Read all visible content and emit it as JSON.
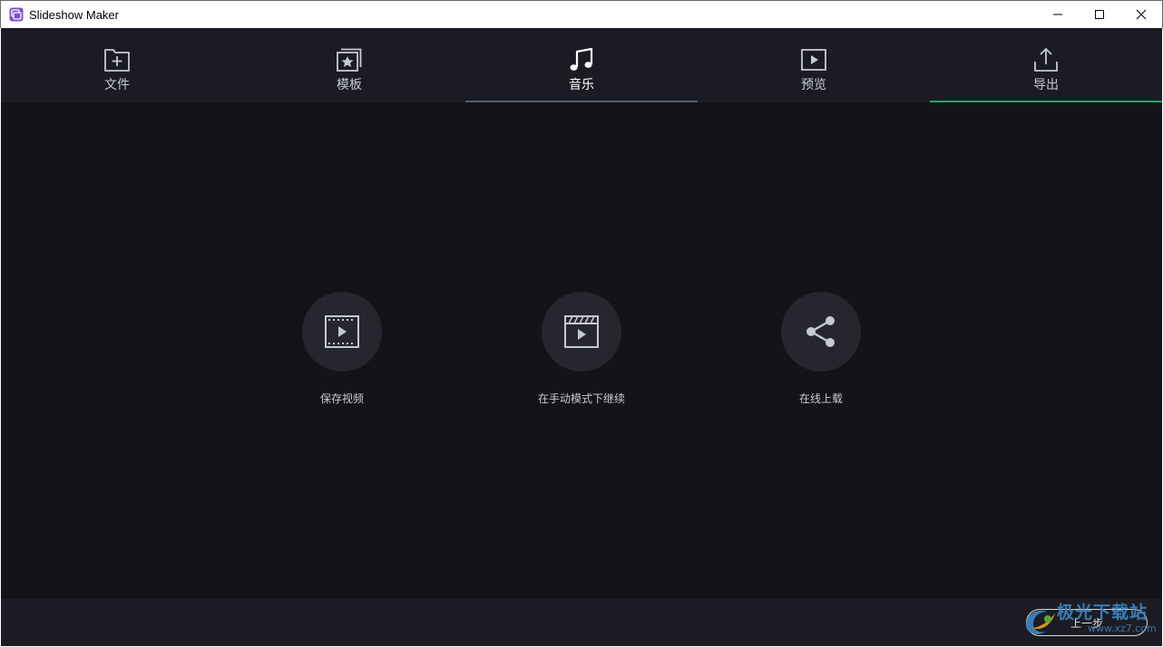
{
  "window": {
    "title": "Slideshow Maker",
    "minimize_icon": "minimize-icon",
    "maximize_icon": "maximize-icon",
    "close_icon": "close-icon"
  },
  "tabs": [
    {
      "label": "文件",
      "icon": "folder-add-icon"
    },
    {
      "label": "模板",
      "icon": "template-star-icon"
    },
    {
      "label": "音乐",
      "icon": "music-note-icon"
    },
    {
      "label": "预览",
      "icon": "play-preview-icon"
    },
    {
      "label": "导出",
      "icon": "upload-export-icon"
    }
  ],
  "active_tab": "导出",
  "options": [
    {
      "label": "保存视频",
      "icon": "film-play-icon"
    },
    {
      "label": "在手动模式下继续",
      "icon": "clapperboard-icon"
    },
    {
      "label": "在线上载",
      "icon": "share-icon"
    }
  ],
  "footer": {
    "back_label": "上一步"
  },
  "watermark": {
    "text": "极光下载站",
    "url": "www.xz7.com"
  },
  "colors": {
    "background": "#131418",
    "tabbar": "#1b1c23",
    "active_underline": "#1fa866",
    "music_underline": "#5a5c68",
    "option_circle": "#25262e"
  }
}
